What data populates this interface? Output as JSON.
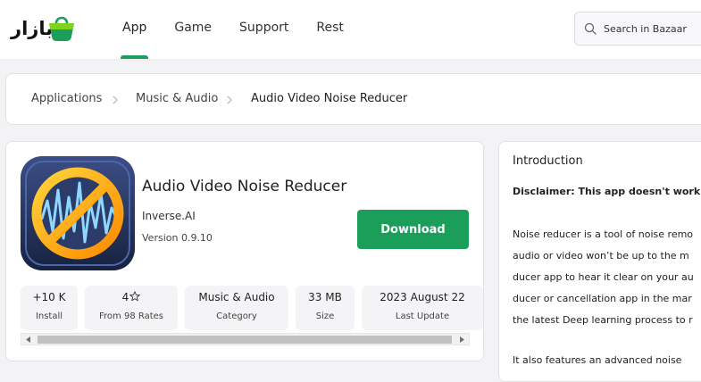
{
  "brand": {
    "logo_text": "بازار",
    "accent": "#1a9e59"
  },
  "nav": [
    {
      "label": "App",
      "active": true
    },
    {
      "label": "Game",
      "active": false
    },
    {
      "label": "Support",
      "active": false
    },
    {
      "label": "Rest",
      "active": false
    }
  ],
  "search": {
    "placeholder": "Search in Bazaar",
    "icon": "search-icon"
  },
  "breadcrumb": {
    "items": [
      "Applications",
      "Music & Audio"
    ],
    "current": "Audio Video Noise Reducer"
  },
  "app": {
    "title": "Audio Video Noise Reducer",
    "developer": "Inverse.AI",
    "version": "Version 0.9.10",
    "download_label": "Download",
    "icon": "noise-reducer-app-icon"
  },
  "stats": [
    {
      "value": "+10 K",
      "label": "Install"
    },
    {
      "value": "4",
      "label": "From 98 Rates",
      "icon": "star-icon"
    },
    {
      "value": "Music & Audio",
      "label": "Category"
    },
    {
      "value": "33 MB",
      "label": "Size"
    },
    {
      "value": "2023 August 22",
      "label": "Last Update"
    }
  ],
  "intro": {
    "title": "Introduction",
    "disclaimer": "Disclaimer: This app doesn't work w",
    "lines": [
      "Noise reducer is a tool of noise remo",
      "audio or video won’t be up to the m",
      "ducer app to hear it clear on your au",
      "ducer or cancellation app in the mar",
      "the latest Deep learning process to r",
      "It also features an advanced noise"
    ]
  }
}
